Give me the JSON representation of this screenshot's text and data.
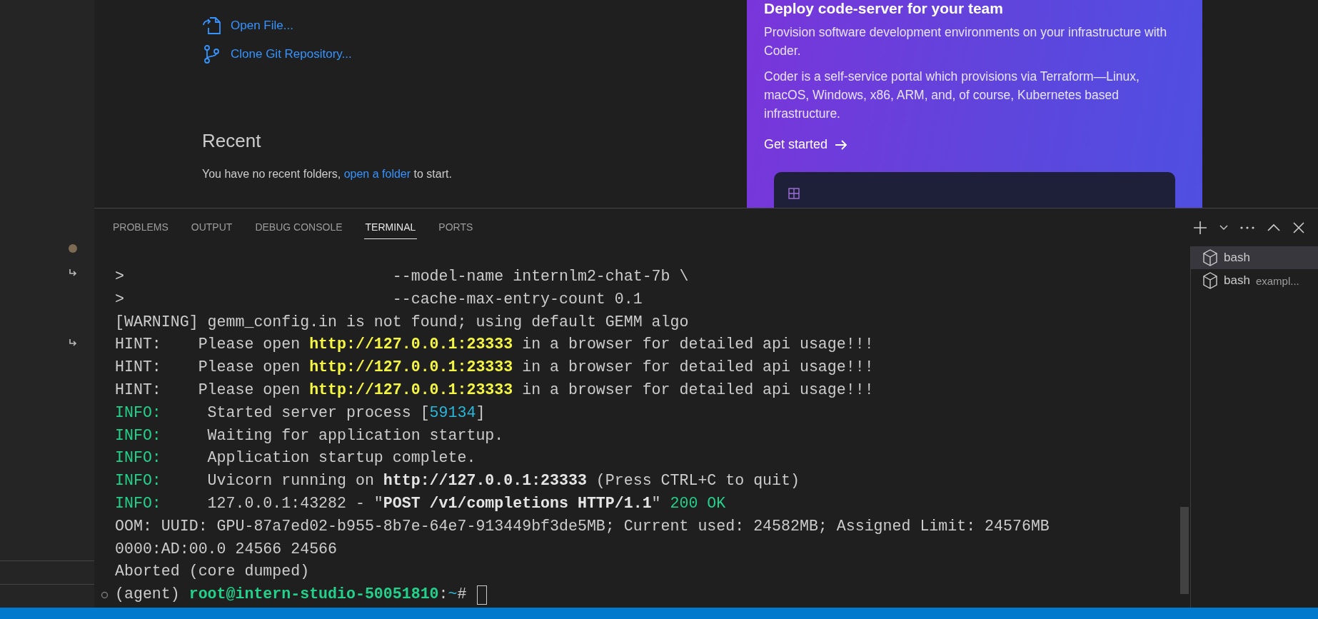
{
  "sidebar": {
    "markers": [
      {
        "kind": "dot"
      },
      {
        "kind": "arrow"
      },
      {
        "kind": "arrow"
      }
    ]
  },
  "welcome": {
    "start_items": [
      {
        "kind": "file",
        "label": "Open File..."
      },
      {
        "kind": "git",
        "label": "Clone Git Repository..."
      }
    ],
    "recent": {
      "title": "Recent",
      "message": "You have no recent folders,",
      "link": "open a folder",
      "message_end": "to start."
    }
  },
  "promo": {
    "title": "Deploy code-server for your team",
    "paragraphs": [
      "Provision software development environments on your infrastructure with Coder.",
      "Coder is a self-service portal which provisions via Terraform—Linux, macOS, Windows, x86, ARM, and, of course, Kubernetes based infrastructure."
    ],
    "cta": "Get started"
  },
  "panel": {
    "tabs": [
      {
        "label": "PROBLEMS",
        "selected": false
      },
      {
        "label": "OUTPUT",
        "selected": false
      },
      {
        "label": "DEBUG CONSOLE",
        "selected": false
      },
      {
        "label": "TERMINAL",
        "selected": true
      },
      {
        "label": "PORTS",
        "selected": false
      }
    ],
    "terminal": {
      "lines": [
        {
          "kind": "output",
          "segments": [
            {
              "text": ">                             --model-name internlm2-chat-7b \\",
              "kind": "plain"
            }
          ]
        },
        {
          "kind": "output",
          "segments": [
            {
              "text": ">                             --cache-max-entry-count 0.1",
              "kind": "plain"
            }
          ]
        },
        {
          "kind": "output",
          "segments": [
            {
              "text": "[WARNING] gemm_config.in is not found; using default GEMM algo",
              "kind": "plain"
            }
          ]
        },
        {
          "kind": "output",
          "segments": [
            {
              "text": "HINT:    Please open ",
              "kind": "plain"
            },
            {
              "text": "http://127.0.0.1:23333",
              "kind": "url"
            },
            {
              "text": " in a browser for detailed api usage!!!",
              "kind": "plain"
            }
          ]
        },
        {
          "kind": "output",
          "segments": [
            {
              "text": "HINT:    Please open ",
              "kind": "plain"
            },
            {
              "text": "http://127.0.0.1:23333",
              "kind": "url"
            },
            {
              "text": " in a browser for detailed api usage!!!",
              "kind": "plain"
            }
          ]
        },
        {
          "kind": "output",
          "segments": [
            {
              "text": "HINT:    Please open ",
              "kind": "plain"
            },
            {
              "text": "http://127.0.0.1:23333",
              "kind": "url"
            },
            {
              "text": " in a browser for detailed api usage!!!",
              "kind": "plain"
            }
          ]
        },
        {
          "kind": "output",
          "segments": [
            {
              "text": "INFO:",
              "kind": "green"
            },
            {
              "text": "     Started server process [",
              "kind": "plain"
            },
            {
              "text": "59134",
              "kind": "number"
            },
            {
              "text": "]",
              "kind": "plain"
            }
          ]
        },
        {
          "kind": "output",
          "segments": [
            {
              "text": "INFO:",
              "kind": "green"
            },
            {
              "text": "     Waiting for application startup.",
              "kind": "plain"
            }
          ]
        },
        {
          "kind": "output",
          "segments": [
            {
              "text": "INFO:",
              "kind": "green"
            },
            {
              "text": "     Application startup complete.",
              "kind": "plain"
            }
          ]
        },
        {
          "kind": "output",
          "segments": [
            {
              "text": "INFO:",
              "kind": "green"
            },
            {
              "text": "     Uvicorn running on ",
              "kind": "plain"
            },
            {
              "text": "http://127.0.0.1:23333",
              "kind": "bold"
            },
            {
              "text": " (Press CTRL+C to quit)",
              "kind": "plain"
            }
          ]
        },
        {
          "kind": "output",
          "segments": [
            {
              "text": "INFO:",
              "kind": "green"
            },
            {
              "text": "     127.0.0.1:43282 - \"",
              "kind": "plain"
            },
            {
              "text": "POST /v1/completions HTTP/1.1",
              "kind": "bold"
            },
            {
              "text": "\" ",
              "kind": "plain"
            },
            {
              "text": "200 OK",
              "kind": "green"
            }
          ]
        },
        {
          "kind": "output",
          "segments": [
            {
              "text": "OOM: UUID: GPU-87a7ed02-b955-8b7e-64e7-913449bf3de5MB; Current used: 24582MB; Assigned Limit: 24576MB",
              "kind": "plain"
            }
          ]
        },
        {
          "kind": "output",
          "segments": [
            {
              "text": "0000:AD:00.0 24566 24566",
              "kind": "plain"
            }
          ]
        },
        {
          "kind": "output",
          "segments": [
            {
              "text": "Aborted (core dumped)",
              "kind": "plain"
            }
          ]
        },
        {
          "kind": "prompt",
          "segments": [
            {
              "text": "(agent) ",
              "kind": "plain"
            },
            {
              "text": "root@intern-studio-50051810",
              "kind": "green-bold"
            },
            {
              "text": ":",
              "kind": "plain"
            },
            {
              "text": "~",
              "kind": "number"
            },
            {
              "text": "# ",
              "kind": "plain"
            }
          ]
        }
      ]
    },
    "sessions": [
      {
        "name": "bash",
        "selected": true
      },
      {
        "name": "bash",
        "detail": "exampl...",
        "selected": false
      }
    ]
  }
}
